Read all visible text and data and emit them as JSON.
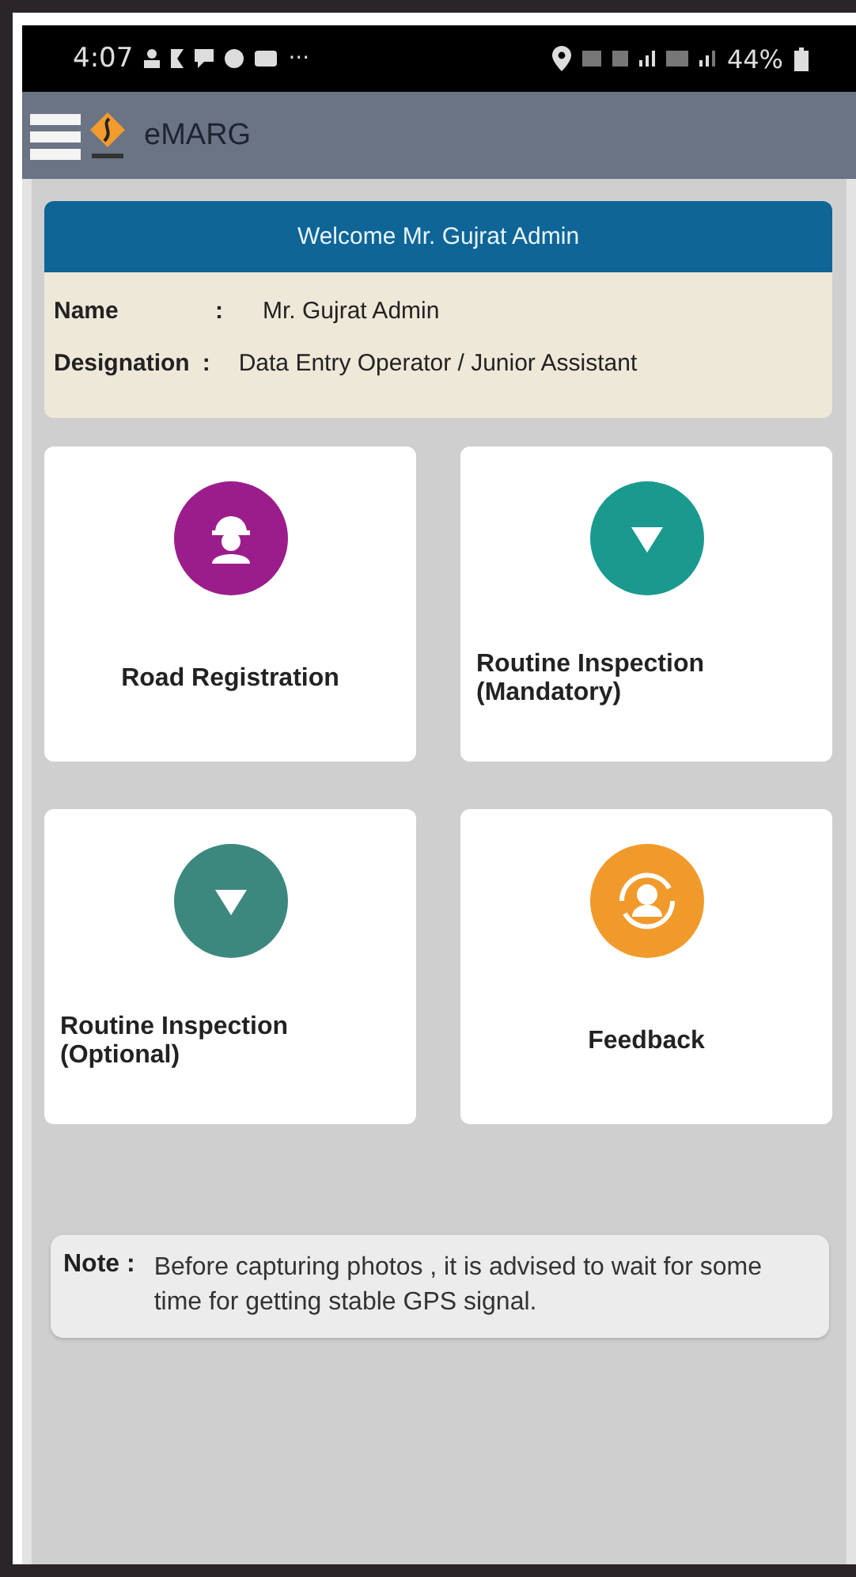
{
  "status_bar": {
    "time": "4:07",
    "more": "···",
    "battery": "44%"
  },
  "app_bar": {
    "title": "eMARG"
  },
  "profile": {
    "welcome": "Welcome Mr. Gujrat Admin",
    "fields": [
      {
        "label": "Name",
        "separator": ":",
        "value": "Mr. Gujrat Admin"
      },
      {
        "label": "Designation",
        "separator": ":",
        "value": "Data Entry Operator / Junior Assistant"
      }
    ]
  },
  "tiles": [
    {
      "label": "Road Registration",
      "kind": "worker",
      "color": "#9b1d8c"
    },
    {
      "label": "Routine Inspection (Mandatory)",
      "kind": "triangle",
      "color": "#1a9a8f"
    },
    {
      "label": "Routine Inspection (Optional)",
      "kind": "triangle",
      "color": "#3d887e"
    },
    {
      "label": "Feedback",
      "kind": "feedback",
      "color": "#f19a2c"
    }
  ],
  "note": {
    "label": "Note :",
    "text": "Before capturing photos , it is advised to wait for some time for getting stable GPS signal."
  }
}
